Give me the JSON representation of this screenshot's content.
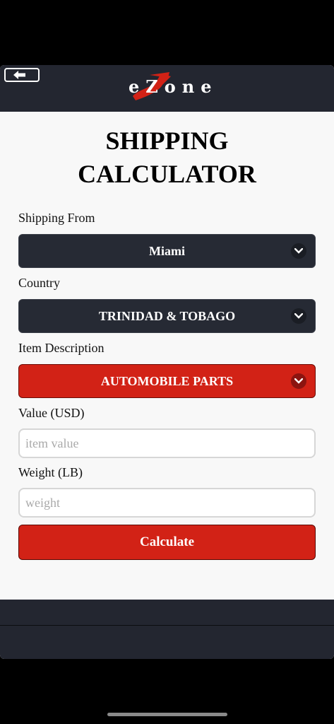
{
  "header": {
    "logo_text": "eZone",
    "back_icon": "arrow-left-icon"
  },
  "page": {
    "title_line1": "SHIPPING",
    "title_line2": "CALCULATOR"
  },
  "form": {
    "shipping_from": {
      "label": "Shipping From",
      "value": "Miami"
    },
    "country": {
      "label": "Country",
      "value": "TRINIDAD & TOBAGO"
    },
    "item_description": {
      "label": "Item Description",
      "value": "AUTOMOBILE PARTS"
    },
    "value_usd": {
      "label": "Value (USD)",
      "placeholder": "item value"
    },
    "weight": {
      "label": "Weight (LB)",
      "placeholder": "weight"
    },
    "calculate_label": "Calculate"
  },
  "colors": {
    "dark": "#262a34",
    "accent_red": "#d22216",
    "background": "#f8f8f8"
  }
}
